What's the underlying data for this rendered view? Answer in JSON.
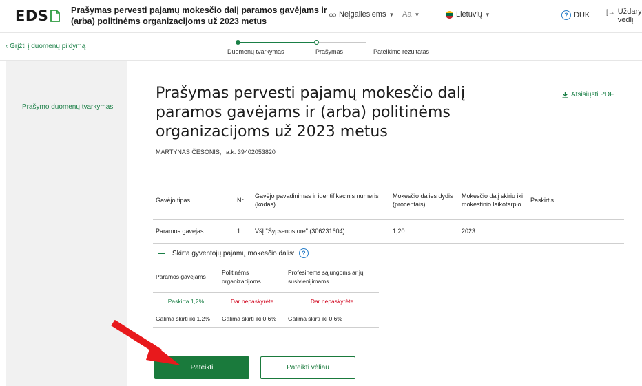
{
  "header": {
    "logo_text": "EDS",
    "app_title": "Prašymas pervesti pajamų mokesčio dalį paramos gavėjams ir (arba) politinėms organizacijoms už 2023 metus",
    "accessibility_label": "Neįgaliesiems",
    "font_label": "Aa",
    "language_label": "Lietuvių",
    "duk_label": "DUK",
    "close_label_line1": "Uždary",
    "close_label_line2": "vedlį"
  },
  "subnav": {
    "back_label": "Grįžti į duomenų pildymą",
    "steps": [
      {
        "label": "Duomenų tvarkymas"
      },
      {
        "label": "Prašymas"
      },
      {
        "label": "Pateikimo rezultatas"
      }
    ]
  },
  "sidebar": {
    "items": [
      {
        "label": "Prašymo duomenų tvarkymas"
      }
    ]
  },
  "main": {
    "title": "Prašymas pervesti pajamų mokesčio dalį paramos gavėjams ir (arba) politinėms organizacijoms už 2023 metus",
    "download_label": "Atsisiųsti PDF",
    "person_name": "MARTYNAS ČESONIS,",
    "person_code": "a.k. 39402053820",
    "table": {
      "headers": [
        "Gavėjo tipas",
        "Nr.",
        "Gavėjo pavadinimas ir identifikacinis numeris (kodas)",
        "Mokesčio dalies dydis (procentais)",
        "Mokesčio dalį skiriu iki mokestinio laikotarpio",
        "Paskirtis"
      ],
      "rows": [
        [
          "Paramos gavėjas",
          "1",
          "VšĮ \"Šypsenos ore\" (306231604)",
          "1,20",
          "2023",
          ""
        ]
      ]
    },
    "allocation": {
      "heading": "Skirta gyventojų pajamų mokesčio dalis:",
      "headers": [
        "Paramos gavėjams",
        "Politinėms organizacijoms",
        "Profesinėms sąjungoms ar jų susivienijimams"
      ],
      "status_row": [
        "Paskirta 1,2%",
        "Dar nepaskyrėte",
        "Dar nepaskyrėte"
      ],
      "limit_row": [
        "Galima skirti iki 1,2%",
        "Galima skirti iki 0,6%",
        "Galima skirti iki 0,6%"
      ]
    },
    "buttons": {
      "submit": "Pateikti",
      "submit_later": "Pateikti vėliau"
    }
  },
  "colors": {
    "accent": "#1a7a3c",
    "link": "#1a7f46",
    "warning": "#d0021b",
    "annotation_arrow": "#e8191c"
  }
}
